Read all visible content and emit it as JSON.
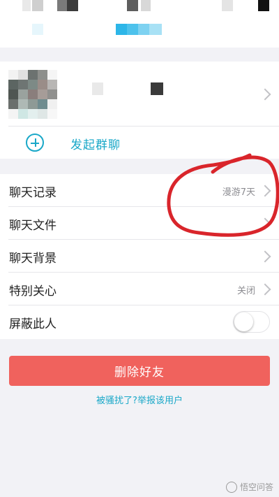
{
  "profile": {
    "avatar": "blurred-avatar"
  },
  "start_group_chat": {
    "label": "发起群聊",
    "icon": "plus-circle-icon"
  },
  "settings": [
    {
      "label": "聊天记录",
      "value": "漫游7天",
      "control": "chevron"
    },
    {
      "label": "聊天文件",
      "value": "",
      "control": "chevron"
    },
    {
      "label": "聊天背景",
      "value": "",
      "control": "chevron"
    },
    {
      "label": "特别关心",
      "value": "关闭",
      "control": "chevron"
    },
    {
      "label": "屏蔽此人",
      "value": "",
      "control": "toggle",
      "toggle_on": false
    }
  ],
  "actions": {
    "delete_friend": "删除好友",
    "report_link": "被骚扰了?举报该用户"
  },
  "colors": {
    "accent": "#1aa8c8",
    "danger": "#f0625d",
    "annotation": "#d9252b"
  },
  "watermark": {
    "text": "悟空问答"
  }
}
